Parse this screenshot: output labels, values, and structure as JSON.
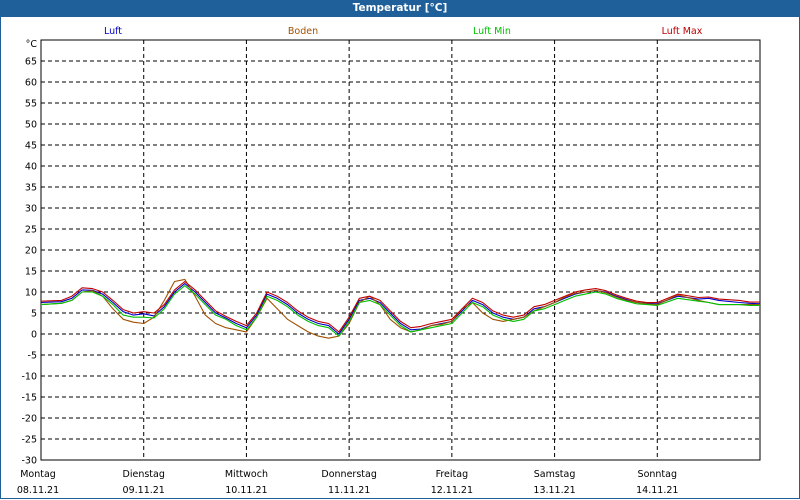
{
  "window": {
    "title": "Temperatur [°C]"
  },
  "chart_data": {
    "type": "line",
    "title": "Temperatur [°C]",
    "ylabel": "°C",
    "ylim": [
      -30,
      70
    ],
    "yticks": [
      -30,
      -25,
      -20,
      -15,
      -10,
      -5,
      0,
      5,
      10,
      15,
      20,
      25,
      30,
      35,
      40,
      45,
      50,
      55,
      60,
      65
    ],
    "grid": true,
    "legend_position": "top",
    "x_start": "08.11.21 00:00",
    "xlim_days": [
      0,
      7
    ],
    "x_ticks": [
      {
        "day": "Montag",
        "date": "08.11.21"
      },
      {
        "day": "Dienstag",
        "date": "09.11.21"
      },
      {
        "day": "Mittwoch",
        "date": "10.11.21"
      },
      {
        "day": "Donnerstag",
        "date": "11.11.21"
      },
      {
        "day": "Freitag",
        "date": "12.11.21"
      },
      {
        "day": "Samstag",
        "date": "13.11.21"
      },
      {
        "day": "Sonntag",
        "date": "14.11.21"
      }
    ],
    "series": [
      {
        "name": "Luft",
        "color": "#0000c8",
        "x": [
          0,
          0.2,
          0.3,
          0.4,
          0.5,
          0.6,
          0.7,
          0.8,
          0.9,
          1.0,
          1.1,
          1.2,
          1.3,
          1.4,
          1.5,
          1.6,
          1.7,
          1.8,
          1.9,
          2.0,
          2.1,
          2.2,
          2.3,
          2.4,
          2.5,
          2.6,
          2.7,
          2.8,
          2.9,
          3.0,
          3.1,
          3.2,
          3.3,
          3.4,
          3.5,
          3.6,
          3.7,
          3.8,
          3.9,
          4.0,
          4.1,
          4.2,
          4.3,
          4.4,
          4.5,
          4.6,
          4.7,
          4.8,
          4.9,
          5.0,
          5.1,
          5.2,
          5.3,
          5.4,
          5.5,
          5.6,
          5.7,
          5.8,
          5.9,
          6.0,
          6.2,
          6.4,
          6.5,
          6.6,
          6.8,
          6.9,
          7.0
        ],
        "y": [
          7.5,
          7.7,
          8.5,
          10.5,
          10.4,
          9.5,
          7.5,
          5.3,
          4.5,
          4.8,
          4.3,
          6.5,
          10.0,
          12.0,
          10.0,
          7.5,
          5.0,
          3.8,
          2.5,
          1.5,
          4.5,
          9.5,
          8.5,
          7.0,
          5.0,
          3.5,
          2.5,
          2.0,
          0.0,
          3.5,
          8.0,
          8.5,
          7.5,
          5.0,
          2.5,
          1.0,
          1.2,
          2.0,
          2.5,
          3.0,
          5.5,
          8.0,
          7.0,
          5.0,
          4.0,
          3.5,
          4.0,
          6.0,
          6.5,
          7.5,
          8.5,
          9.5,
          10.0,
          10.3,
          10.0,
          9.0,
          8.2,
          7.5,
          7.3,
          7.2,
          9.0,
          8.3,
          8.5,
          8.0,
          7.5,
          7.3,
          7.2
        ]
      },
      {
        "name": "Boden",
        "color": "#a05000",
        "x": [
          0,
          0.2,
          0.3,
          0.4,
          0.5,
          0.6,
          0.7,
          0.8,
          0.9,
          1.0,
          1.1,
          1.2,
          1.3,
          1.4,
          1.5,
          1.6,
          1.7,
          1.8,
          1.9,
          2.0,
          2.1,
          2.2,
          2.3,
          2.4,
          2.5,
          2.6,
          2.7,
          2.8,
          2.9,
          3.0,
          3.1,
          3.2,
          3.3,
          3.4,
          3.5,
          3.6,
          3.7,
          3.8,
          3.9,
          4.0,
          4.1,
          4.2,
          4.3,
          4.4,
          4.5,
          4.6,
          4.7,
          4.8,
          4.9,
          5.0,
          5.1,
          5.2,
          5.3,
          5.4,
          5.5,
          5.6,
          5.7,
          5.8,
          5.9,
          6.0,
          6.2,
          6.4,
          6.5,
          6.6,
          6.8,
          6.9,
          7.0
        ],
        "y": [
          7.0,
          7.3,
          8.0,
          10.0,
          10.3,
          9.0,
          6.0,
          3.5,
          2.8,
          2.5,
          4.0,
          8.0,
          12.5,
          13.0,
          9.0,
          4.5,
          2.5,
          1.5,
          1.0,
          0.5,
          4.0,
          8.5,
          6.0,
          3.5,
          2.0,
          0.5,
          -0.5,
          -1.0,
          -0.5,
          2.5,
          7.5,
          9.0,
          7.0,
          3.5,
          1.5,
          0.5,
          1.0,
          2.0,
          2.3,
          3.0,
          6.0,
          7.5,
          5.0,
          3.5,
          3.0,
          3.5,
          4.0,
          5.5,
          6.5,
          7.5,
          8.8,
          9.7,
          10.0,
          10.4,
          9.8,
          8.8,
          8.0,
          7.5,
          7.2,
          7.0,
          9.3,
          8.0,
          7.5,
          7.0,
          7.0,
          7.0,
          7.0
        ]
      },
      {
        "name": "Luft Min",
        "color": "#00c000",
        "x": [
          0,
          0.2,
          0.3,
          0.4,
          0.5,
          0.6,
          0.7,
          0.8,
          0.9,
          1.0,
          1.1,
          1.2,
          1.3,
          1.4,
          1.5,
          1.6,
          1.7,
          1.8,
          1.9,
          2.0,
          2.1,
          2.2,
          2.3,
          2.4,
          2.5,
          2.6,
          2.7,
          2.8,
          2.9,
          3.0,
          3.1,
          3.2,
          3.3,
          3.4,
          3.5,
          3.6,
          3.7,
          3.8,
          3.9,
          4.0,
          4.1,
          4.2,
          4.3,
          4.4,
          4.5,
          4.6,
          4.7,
          4.8,
          4.9,
          5.0,
          5.1,
          5.2,
          5.3,
          5.4,
          5.5,
          5.6,
          5.7,
          5.8,
          5.9,
          6.0,
          6.2,
          6.4,
          6.5,
          6.6,
          6.8,
          6.9,
          7.0
        ],
        "y": [
          7.0,
          7.3,
          8.0,
          10.0,
          10.0,
          9.0,
          7.0,
          4.5,
          4.0,
          4.0,
          3.8,
          6.0,
          9.5,
          11.5,
          9.5,
          7.0,
          4.5,
          3.5,
          2.0,
          1.0,
          4.0,
          9.0,
          8.0,
          6.5,
          4.5,
          3.0,
          2.0,
          1.5,
          -0.5,
          3.0,
          7.5,
          8.0,
          7.0,
          4.5,
          2.0,
          0.5,
          1.0,
          1.5,
          2.0,
          2.5,
          5.0,
          7.5,
          6.5,
          4.5,
          3.5,
          3.0,
          3.5,
          5.5,
          6.0,
          7.0,
          8.0,
          9.0,
          9.5,
          10.0,
          9.5,
          8.5,
          7.8,
          7.2,
          7.0,
          6.8,
          8.5,
          7.8,
          7.5,
          7.0,
          7.0,
          6.8,
          6.8
        ]
      },
      {
        "name": "Luft Max",
        "color": "#c00000",
        "x": [
          0,
          0.2,
          0.3,
          0.4,
          0.5,
          0.6,
          0.7,
          0.8,
          0.9,
          1.0,
          1.1,
          1.2,
          1.3,
          1.4,
          1.5,
          1.6,
          1.7,
          1.8,
          1.9,
          2.0,
          2.1,
          2.2,
          2.3,
          2.4,
          2.5,
          2.6,
          2.7,
          2.8,
          2.9,
          3.0,
          3.1,
          3.2,
          3.3,
          3.4,
          3.5,
          3.6,
          3.7,
          3.8,
          3.9,
          4.0,
          4.1,
          4.2,
          4.3,
          4.4,
          4.5,
          4.6,
          4.7,
          4.8,
          4.9,
          5.0,
          5.1,
          5.2,
          5.3,
          5.4,
          5.5,
          5.6,
          5.7,
          5.8,
          5.9,
          6.0,
          6.2,
          6.4,
          6.5,
          6.6,
          6.8,
          6.9,
          7.0
        ],
        "y": [
          7.8,
          8.0,
          9.0,
          11.0,
          10.8,
          10.0,
          8.0,
          5.8,
          5.0,
          5.3,
          5.0,
          7.0,
          10.5,
          12.5,
          10.5,
          8.0,
          5.5,
          4.2,
          3.0,
          2.0,
          5.0,
          10.0,
          9.0,
          7.5,
          5.5,
          4.0,
          3.0,
          2.5,
          0.5,
          4.0,
          8.5,
          9.0,
          8.0,
          5.5,
          3.0,
          1.5,
          1.8,
          2.5,
          3.0,
          3.5,
          6.0,
          8.5,
          7.5,
          5.5,
          4.5,
          4.0,
          4.5,
          6.5,
          7.0,
          8.0,
          9.0,
          10.0,
          10.5,
          10.8,
          10.3,
          9.3,
          8.5,
          7.8,
          7.5,
          7.5,
          9.5,
          8.7,
          8.8,
          8.3,
          8.0,
          7.6,
          7.6
        ]
      }
    ]
  }
}
